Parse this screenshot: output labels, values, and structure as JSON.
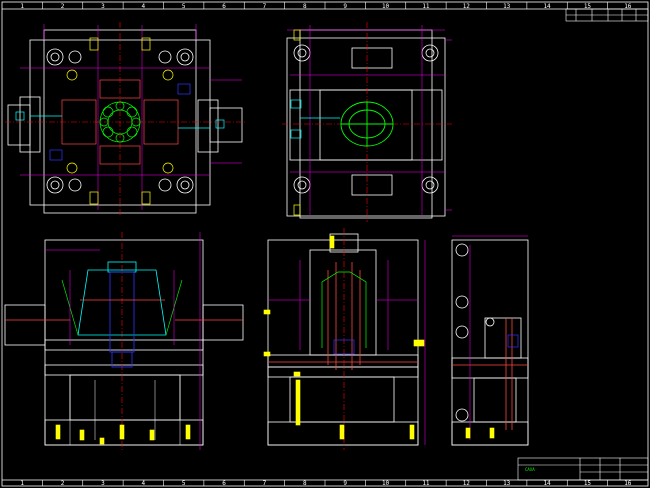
{
  "sheet": {
    "columns_top": [
      "1",
      "2",
      "3",
      "4",
      "5",
      "6",
      "7",
      "8",
      "9",
      "10",
      "11",
      "12",
      "13",
      "14",
      "15",
      "16"
    ],
    "columns_bottom": [
      "1",
      "2",
      "3",
      "4",
      "5",
      "6",
      "7",
      "8",
      "9",
      "10",
      "11",
      "12",
      "13",
      "14",
      "15",
      "16"
    ]
  },
  "title_block": {
    "company": "CAXA"
  },
  "colors": {
    "background": "#000000",
    "frame": "#ffffff",
    "outline": "#ffffff",
    "dimension": "#ff00ff",
    "center": "#ff0000",
    "part_green": "#00ff00",
    "part_yellow": "#ffff00",
    "part_cyan": "#00ffff",
    "part_blue": "#3333ff"
  }
}
